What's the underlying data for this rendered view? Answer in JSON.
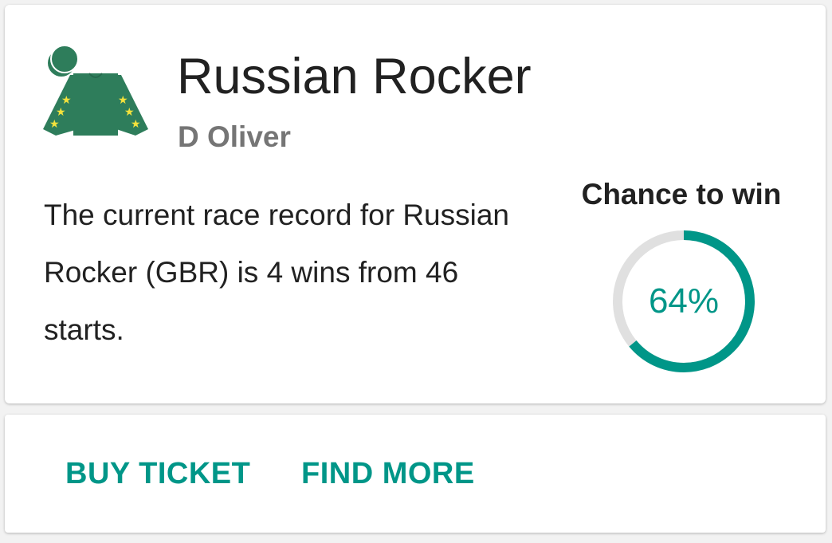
{
  "horse": {
    "name": "Russian Rocker",
    "jockey": "D Oliver",
    "description": "The current race record for Russian Rocker (GBR) is 4 wins from 46 starts.",
    "silks_icon": "jockey-silks-icon",
    "silks_colors": {
      "body": "#2e7d5b",
      "stars": "#f4e23c"
    }
  },
  "chance": {
    "label": "Chance to win",
    "percent": 64,
    "display": "64%",
    "accent": "#009688",
    "track": "#e0e0e0"
  },
  "actions": {
    "buy_label": "BUY TICKET",
    "more_label": "FIND MORE"
  }
}
